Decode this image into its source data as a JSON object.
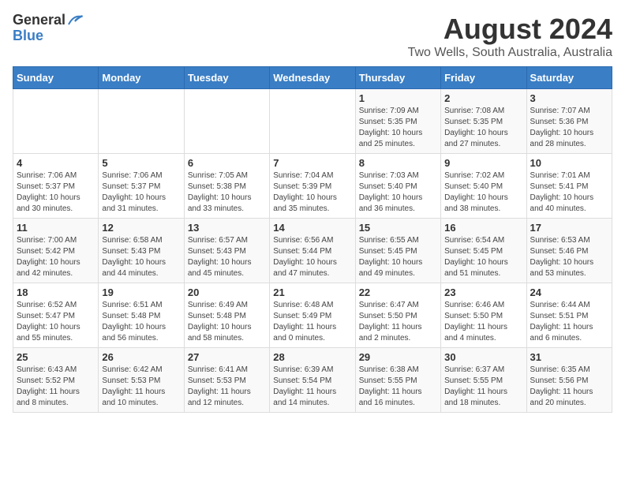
{
  "header": {
    "logo_general": "General",
    "logo_blue": "Blue",
    "month_year": "August 2024",
    "location": "Two Wells, South Australia, Australia"
  },
  "weekdays": [
    "Sunday",
    "Monday",
    "Tuesday",
    "Wednesday",
    "Thursday",
    "Friday",
    "Saturday"
  ],
  "weeks": [
    [
      {
        "day": "",
        "info": ""
      },
      {
        "day": "",
        "info": ""
      },
      {
        "day": "",
        "info": ""
      },
      {
        "day": "",
        "info": ""
      },
      {
        "day": "1",
        "info": "Sunrise: 7:09 AM\nSunset: 5:35 PM\nDaylight: 10 hours\nand 25 minutes."
      },
      {
        "day": "2",
        "info": "Sunrise: 7:08 AM\nSunset: 5:35 PM\nDaylight: 10 hours\nand 27 minutes."
      },
      {
        "day": "3",
        "info": "Sunrise: 7:07 AM\nSunset: 5:36 PM\nDaylight: 10 hours\nand 28 minutes."
      }
    ],
    [
      {
        "day": "4",
        "info": "Sunrise: 7:06 AM\nSunset: 5:37 PM\nDaylight: 10 hours\nand 30 minutes."
      },
      {
        "day": "5",
        "info": "Sunrise: 7:06 AM\nSunset: 5:37 PM\nDaylight: 10 hours\nand 31 minutes."
      },
      {
        "day": "6",
        "info": "Sunrise: 7:05 AM\nSunset: 5:38 PM\nDaylight: 10 hours\nand 33 minutes."
      },
      {
        "day": "7",
        "info": "Sunrise: 7:04 AM\nSunset: 5:39 PM\nDaylight: 10 hours\nand 35 minutes."
      },
      {
        "day": "8",
        "info": "Sunrise: 7:03 AM\nSunset: 5:40 PM\nDaylight: 10 hours\nand 36 minutes."
      },
      {
        "day": "9",
        "info": "Sunrise: 7:02 AM\nSunset: 5:40 PM\nDaylight: 10 hours\nand 38 minutes."
      },
      {
        "day": "10",
        "info": "Sunrise: 7:01 AM\nSunset: 5:41 PM\nDaylight: 10 hours\nand 40 minutes."
      }
    ],
    [
      {
        "day": "11",
        "info": "Sunrise: 7:00 AM\nSunset: 5:42 PM\nDaylight: 10 hours\nand 42 minutes."
      },
      {
        "day": "12",
        "info": "Sunrise: 6:58 AM\nSunset: 5:43 PM\nDaylight: 10 hours\nand 44 minutes."
      },
      {
        "day": "13",
        "info": "Sunrise: 6:57 AM\nSunset: 5:43 PM\nDaylight: 10 hours\nand 45 minutes."
      },
      {
        "day": "14",
        "info": "Sunrise: 6:56 AM\nSunset: 5:44 PM\nDaylight: 10 hours\nand 47 minutes."
      },
      {
        "day": "15",
        "info": "Sunrise: 6:55 AM\nSunset: 5:45 PM\nDaylight: 10 hours\nand 49 minutes."
      },
      {
        "day": "16",
        "info": "Sunrise: 6:54 AM\nSunset: 5:45 PM\nDaylight: 10 hours\nand 51 minutes."
      },
      {
        "day": "17",
        "info": "Sunrise: 6:53 AM\nSunset: 5:46 PM\nDaylight: 10 hours\nand 53 minutes."
      }
    ],
    [
      {
        "day": "18",
        "info": "Sunrise: 6:52 AM\nSunset: 5:47 PM\nDaylight: 10 hours\nand 55 minutes."
      },
      {
        "day": "19",
        "info": "Sunrise: 6:51 AM\nSunset: 5:48 PM\nDaylight: 10 hours\nand 56 minutes."
      },
      {
        "day": "20",
        "info": "Sunrise: 6:49 AM\nSunset: 5:48 PM\nDaylight: 10 hours\nand 58 minutes."
      },
      {
        "day": "21",
        "info": "Sunrise: 6:48 AM\nSunset: 5:49 PM\nDaylight: 11 hours\nand 0 minutes."
      },
      {
        "day": "22",
        "info": "Sunrise: 6:47 AM\nSunset: 5:50 PM\nDaylight: 11 hours\nand 2 minutes."
      },
      {
        "day": "23",
        "info": "Sunrise: 6:46 AM\nSunset: 5:50 PM\nDaylight: 11 hours\nand 4 minutes."
      },
      {
        "day": "24",
        "info": "Sunrise: 6:44 AM\nSunset: 5:51 PM\nDaylight: 11 hours\nand 6 minutes."
      }
    ],
    [
      {
        "day": "25",
        "info": "Sunrise: 6:43 AM\nSunset: 5:52 PM\nDaylight: 11 hours\nand 8 minutes."
      },
      {
        "day": "26",
        "info": "Sunrise: 6:42 AM\nSunset: 5:53 PM\nDaylight: 11 hours\nand 10 minutes."
      },
      {
        "day": "27",
        "info": "Sunrise: 6:41 AM\nSunset: 5:53 PM\nDaylight: 11 hours\nand 12 minutes."
      },
      {
        "day": "28",
        "info": "Sunrise: 6:39 AM\nSunset: 5:54 PM\nDaylight: 11 hours\nand 14 minutes."
      },
      {
        "day": "29",
        "info": "Sunrise: 6:38 AM\nSunset: 5:55 PM\nDaylight: 11 hours\nand 16 minutes."
      },
      {
        "day": "30",
        "info": "Sunrise: 6:37 AM\nSunset: 5:55 PM\nDaylight: 11 hours\nand 18 minutes."
      },
      {
        "day": "31",
        "info": "Sunrise: 6:35 AM\nSunset: 5:56 PM\nDaylight: 11 hours\nand 20 minutes."
      }
    ]
  ]
}
